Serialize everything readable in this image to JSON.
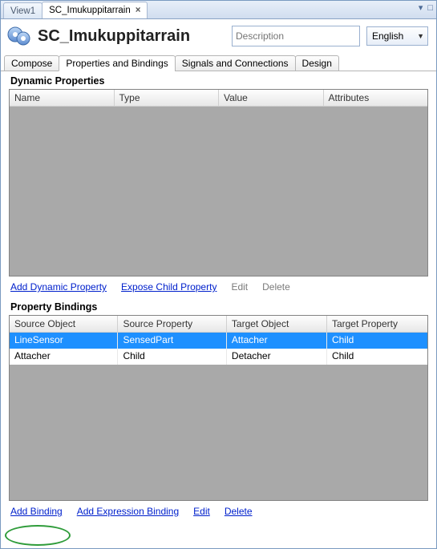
{
  "window_tabs": {
    "inactive_label": "View1",
    "active_label": "SC_Imukuppitarrain"
  },
  "controls": {
    "pin_glyph": "▾",
    "menu_glyph": "□"
  },
  "header": {
    "title": "SC_Imukuppitarrain",
    "desc_placeholder": "Description",
    "language": "English"
  },
  "subtabs": {
    "compose": "Compose",
    "props": "Properties and Bindings",
    "signals": "Signals and Connections",
    "design": "Design"
  },
  "dynprops": {
    "section_title": "Dynamic Properties",
    "columns": {
      "name": "Name",
      "type": "Type",
      "value": "Value",
      "attributes": "Attributes"
    },
    "actions": {
      "add": "Add Dynamic Property",
      "expose": "Expose Child Property",
      "edit": "Edit",
      "delete": "Delete"
    }
  },
  "bindings": {
    "section_title": "Property Bindings",
    "columns": {
      "source_object": "Source Object",
      "source_property": "Source Property",
      "target_object": "Target Object",
      "target_property": "Target Property"
    },
    "rows": [
      {
        "so": "LineSensor",
        "sp": "SensedPart",
        "to": "Attacher",
        "tp": "Child",
        "selected": true
      },
      {
        "so": "Attacher",
        "sp": "Child",
        "to": "Detacher",
        "tp": "Child",
        "selected": false
      }
    ],
    "actions": {
      "add": "Add Binding",
      "add_expr": "Add Expression Binding",
      "edit": "Edit",
      "delete": "Delete"
    }
  }
}
